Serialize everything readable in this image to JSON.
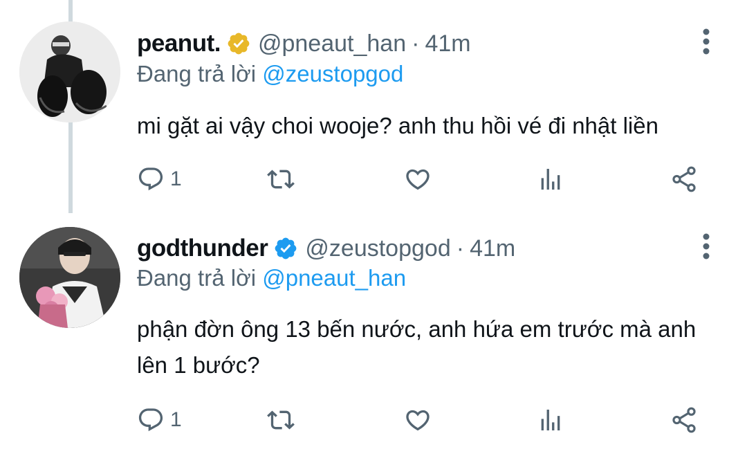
{
  "tweets": [
    {
      "name": "peanut.",
      "handle": "@pneaut_han",
      "separator": "·",
      "time": "41m",
      "replying_prefix": "Đang trả lời",
      "replying_to": "@zeustopgod",
      "text": "mi gặt ai vậy choi wooje? anh thu hồi vé đi nhật liền",
      "reply_count": "1",
      "badge_color": "#e8b829"
    },
    {
      "name": "godthunder",
      "handle": "@zeustopgod",
      "separator": "·",
      "time": "41m",
      "replying_prefix": "Đang trả lời",
      "replying_to": "@pneaut_han",
      "text": "phận đờn ông 13 bến nước, anh hứa em trước mà anh lên 1 bước?",
      "reply_count": "1",
      "badge_color": "#1d9bf0"
    }
  ],
  "icons": {
    "reply": "reply-icon",
    "retweet": "retweet-icon",
    "like": "heart-icon",
    "views": "views-icon",
    "share": "share-icon",
    "more": "more-options-icon"
  },
  "colors": {
    "text": "#0f1419",
    "secondary": "#536471",
    "accent": "#1d9bf0",
    "thread_line": "#cfd9de"
  }
}
